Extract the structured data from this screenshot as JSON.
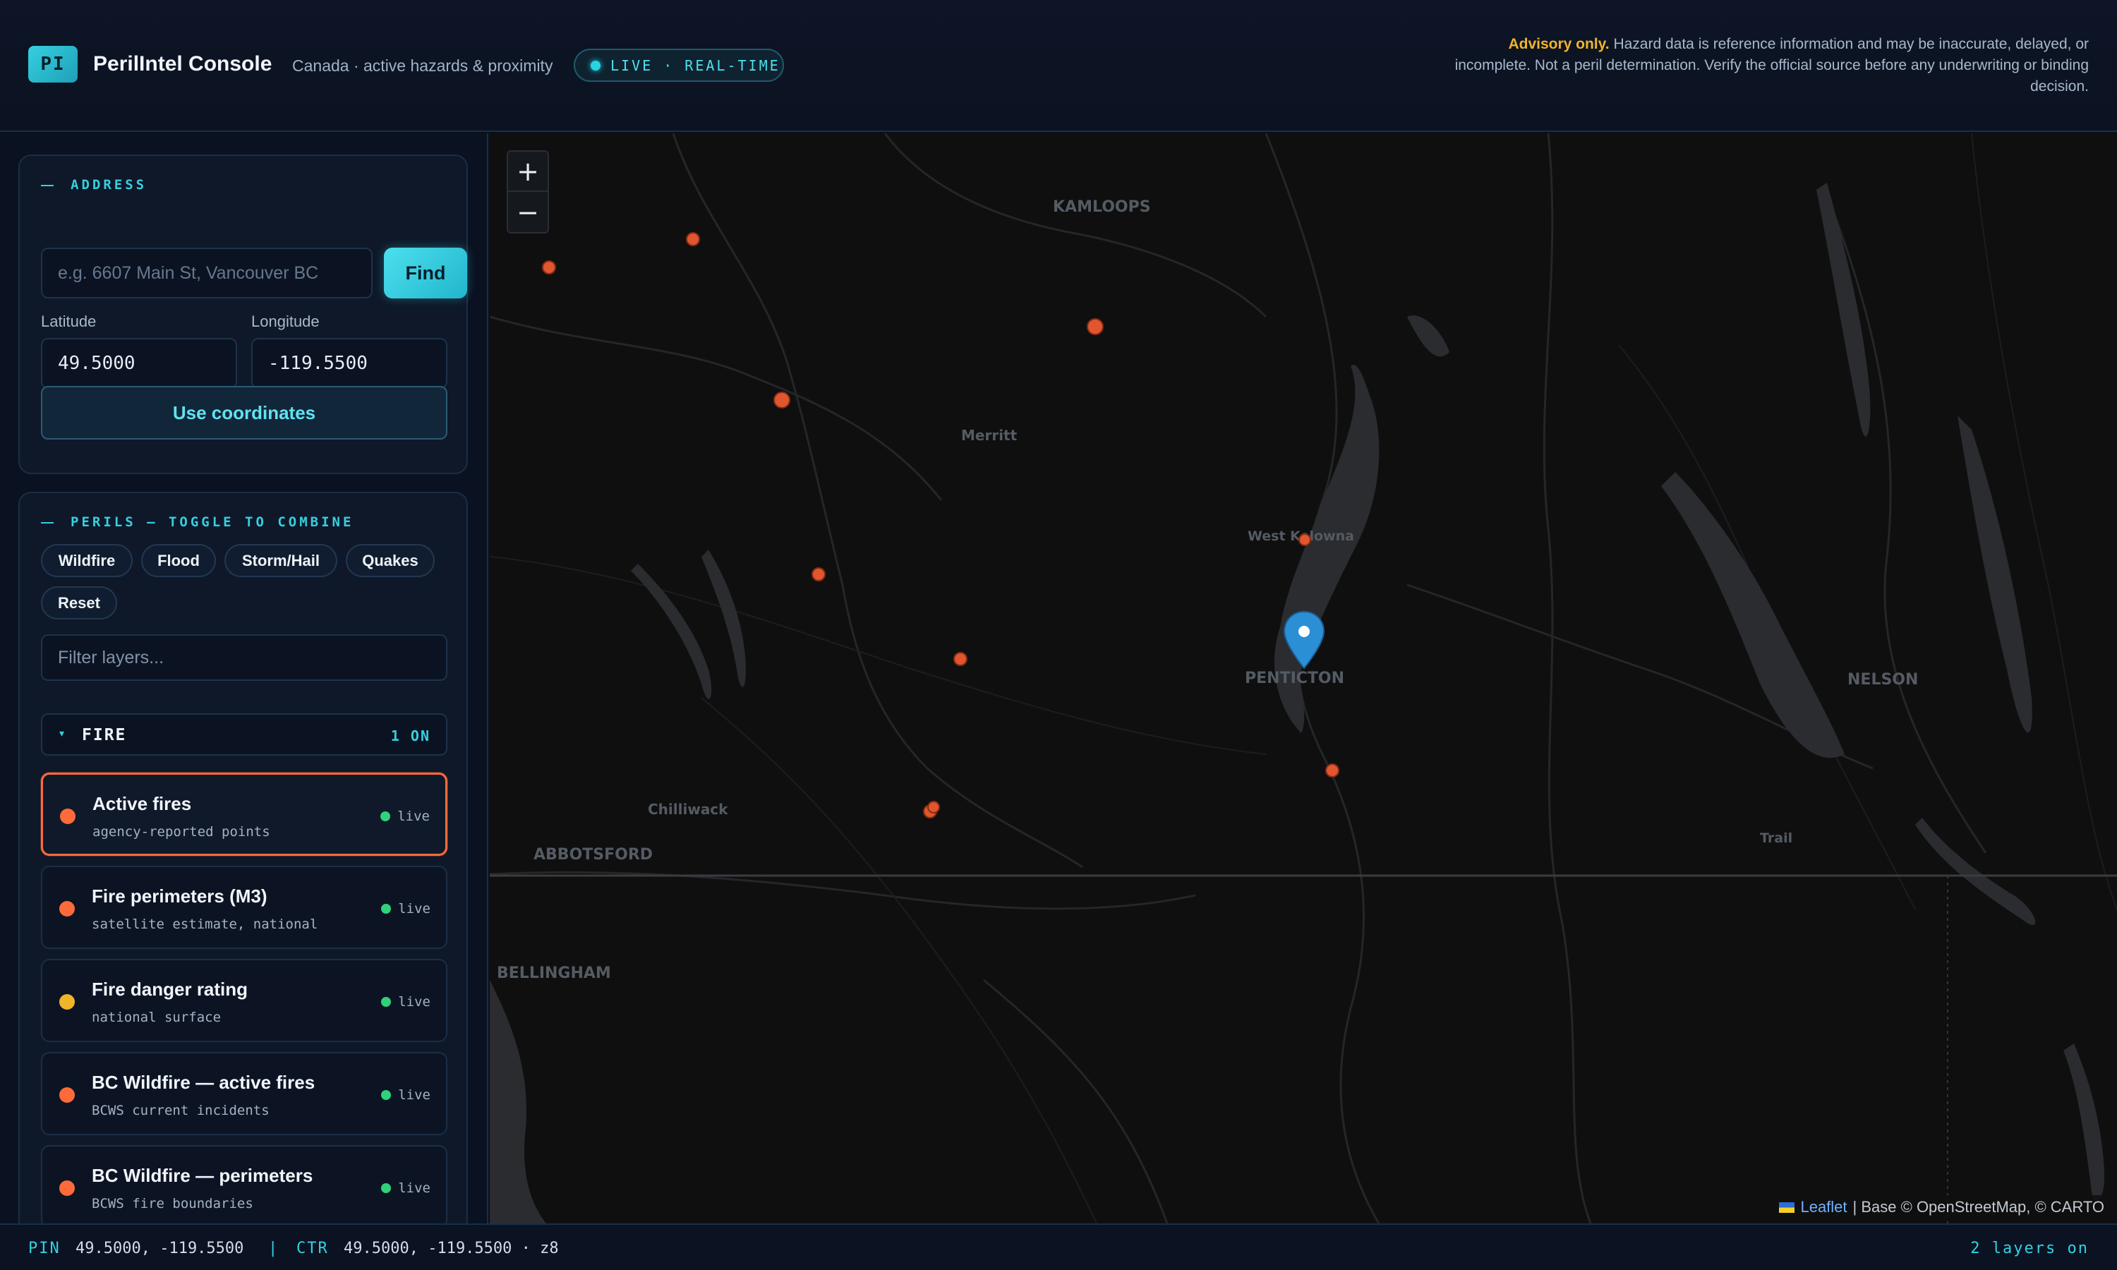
{
  "header": {
    "logo_text": "PI",
    "title": "PerilIntel Console",
    "subtitle": "Canada · active hazards & proximity",
    "status_pill": "LIVE · REAL-TIME",
    "advisory_bold": "Advisory only.",
    "advisory_text": "Hazard data is reference information and may be inaccurate, delayed, or incomplete. Not a peril determination. Verify the official source before any underwriting or binding decision."
  },
  "address": {
    "heading": "ADDRESS",
    "search_placeholder": "e.g. 6607 Main St, Vancouver BC",
    "find_label": "Find",
    "latitude_label": "Latitude",
    "latitude_value": "49.5000",
    "longitude_label": "Longitude",
    "longitude_value": "-119.5500",
    "use_coords_label": "Use coordinates"
  },
  "perils": {
    "heading": "PERILS — TOGGLE TO COMBINE",
    "chips": [
      "Wildfire",
      "Flood",
      "Storm/Hail",
      "Quakes",
      "Reset"
    ],
    "filter_placeholder": "Filter layers...",
    "group": {
      "name": "FIRE",
      "count": "1 ON",
      "caret": "▾"
    },
    "layers": [
      {
        "title": "Active fires",
        "subtitle": "agency-reported points",
        "status": "live",
        "color": "#ff6a3a",
        "active": true
      },
      {
        "title": "Fire perimeters (M3)",
        "subtitle": "satellite estimate, national",
        "status": "live",
        "color": "#ff6a3a",
        "active": false
      },
      {
        "title": "Fire danger rating",
        "subtitle": "national surface",
        "status": "live",
        "color": "#f0b429",
        "active": false
      },
      {
        "title": "BC Wildfire — active fires",
        "subtitle": "BCWS current incidents",
        "status": "live",
        "color": "#ff6a3a",
        "active": false
      },
      {
        "title": "BC Wildfire — perimeters",
        "subtitle": "BCWS fire boundaries",
        "status": "live",
        "color": "#ff6a3a",
        "active": false
      }
    ]
  },
  "map": {
    "zoom_in": "+",
    "zoom_out": "−",
    "places": {
      "kamloops": "KAMLOOPS",
      "merritt": "Merritt",
      "west_kelowna": "West Kelowna",
      "penticton": "PENTICTON",
      "nelson": "NELSON",
      "chilliwack": "Chilliwack",
      "abbotsford": "ABBOTSFORD",
      "trail": "Trail",
      "bellingham": "BELLINGHAM"
    },
    "attribution_link": "Leaflet",
    "attribution_text": "| Base © OpenStreetMap, © CARTO",
    "fire_color": "#e0562e",
    "pin_color": "#2b8fd6"
  },
  "footer": {
    "pin_label": "PIN",
    "pin_value": "49.5000, -119.5500",
    "separator": "|",
    "ctr_label": "CTR",
    "ctr_value": "49.5000, -119.5500 · z8",
    "layers_on": "2 layers on"
  }
}
